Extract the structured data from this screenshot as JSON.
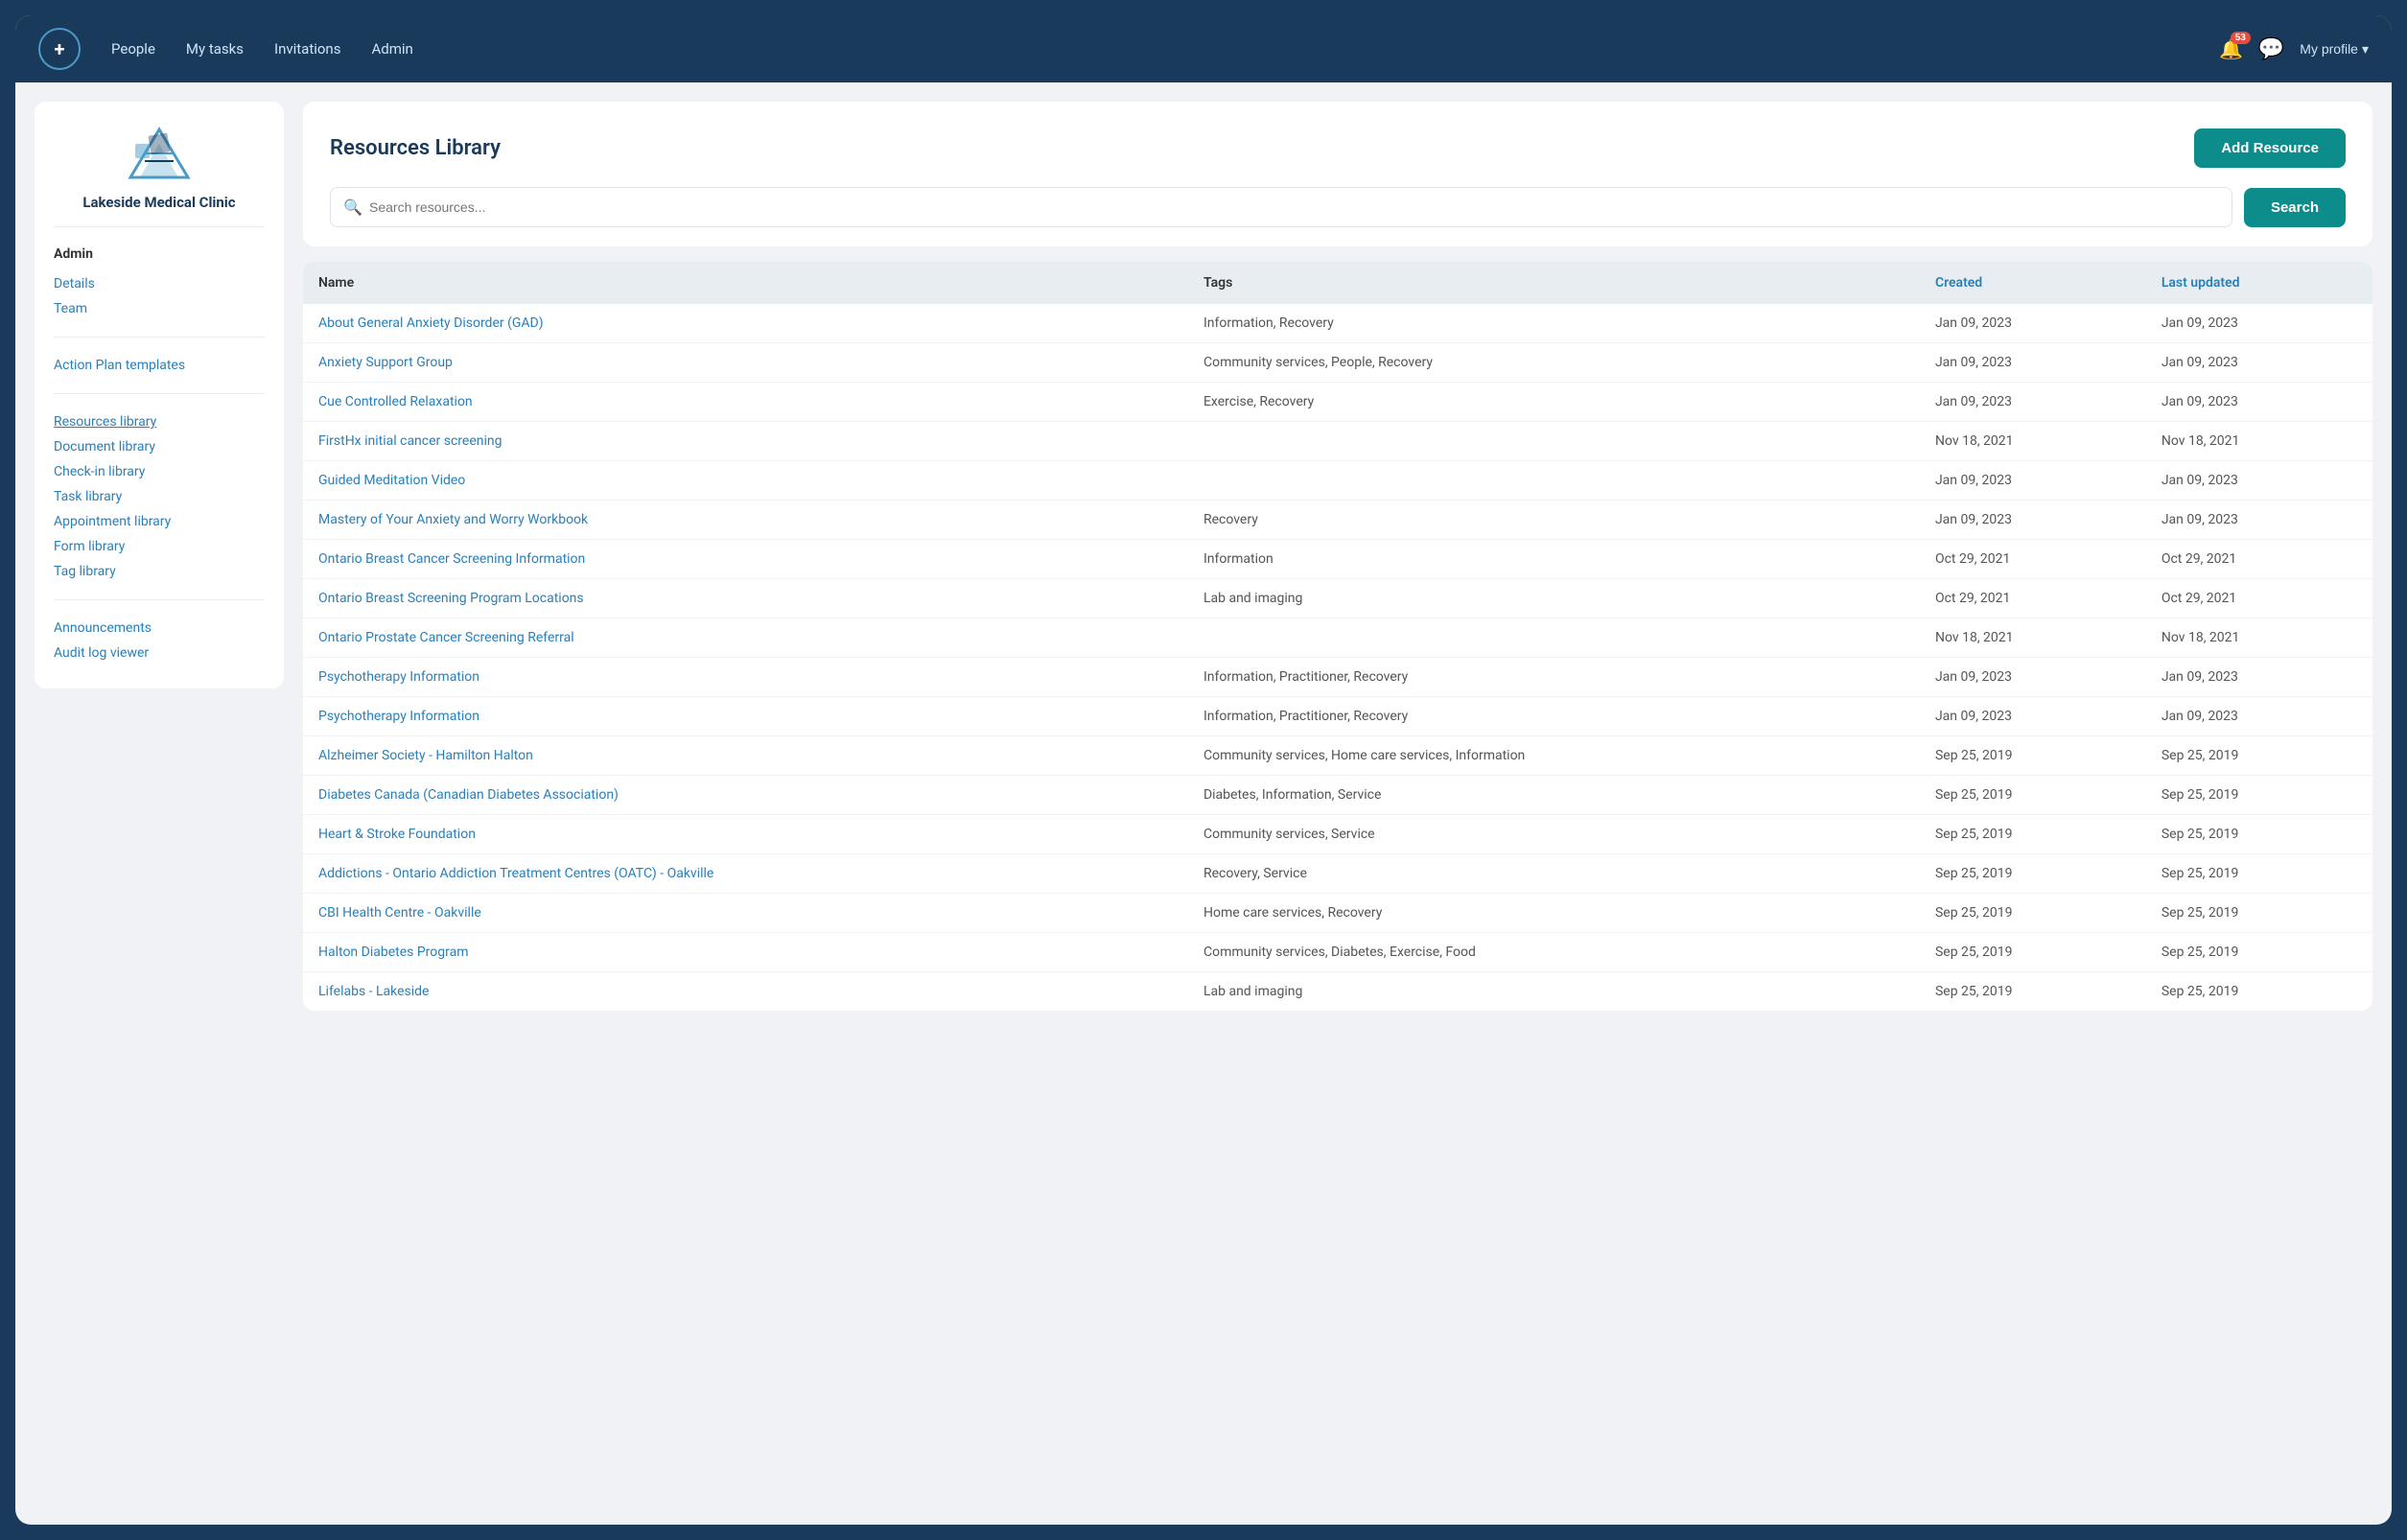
{
  "app": {
    "logo_char": "+"
  },
  "nav": {
    "links": [
      {
        "label": "People",
        "id": "people"
      },
      {
        "label": "My tasks",
        "id": "my-tasks"
      },
      {
        "label": "Invitations",
        "id": "invitations"
      },
      {
        "label": "Admin",
        "id": "admin"
      }
    ],
    "notification_count": "53",
    "profile_label": "My profile"
  },
  "sidebar": {
    "clinic_name": "Lakeside Medical Clinic",
    "admin_section": "Admin",
    "admin_links": [
      {
        "label": "Details",
        "id": "details"
      },
      {
        "label": "Team",
        "id": "team"
      }
    ],
    "action_plan": "Action Plan templates",
    "library_links": [
      {
        "label": "Resources library",
        "id": "resources-library",
        "active": true
      },
      {
        "label": "Document library",
        "id": "document-library"
      },
      {
        "label": "Check-in library",
        "id": "check-in-library"
      },
      {
        "label": "Task library",
        "id": "task-library"
      },
      {
        "label": "Appointment library",
        "id": "appointment-library"
      },
      {
        "label": "Form library",
        "id": "form-library"
      },
      {
        "label": "Tag library",
        "id": "tag-library"
      }
    ],
    "other_links": [
      {
        "label": "Announcements",
        "id": "announcements"
      },
      {
        "label": "Audit log viewer",
        "id": "audit-log-viewer"
      }
    ]
  },
  "resources_panel": {
    "title": "Resources Library",
    "add_button": "Add Resource",
    "search_placeholder": "Search resources...",
    "search_button": "Search"
  },
  "table": {
    "headers": {
      "name": "Name",
      "tags": "Tags",
      "created": "Created",
      "last_updated": "Last updated"
    },
    "rows": [
      {
        "name": "About General Anxiety Disorder (GAD)",
        "tags": "Information, Recovery",
        "created": "Jan 09, 2023",
        "updated": "Jan 09, 2023"
      },
      {
        "name": "Anxiety Support Group",
        "tags": "Community services, People, Recovery",
        "created": "Jan 09, 2023",
        "updated": "Jan 09, 2023"
      },
      {
        "name": "Cue Controlled Relaxation",
        "tags": "Exercise, Recovery",
        "created": "Jan 09, 2023",
        "updated": "Jan 09, 2023"
      },
      {
        "name": "FirstHx initial cancer screening",
        "tags": "",
        "created": "Nov 18, 2021",
        "updated": "Nov 18, 2021"
      },
      {
        "name": "Guided Meditation Video",
        "tags": "",
        "created": "Jan 09, 2023",
        "updated": "Jan 09, 2023"
      },
      {
        "name": "Mastery of Your Anxiety and Worry Workbook",
        "tags": "Recovery",
        "created": "Jan 09, 2023",
        "updated": "Jan 09, 2023"
      },
      {
        "name": "Ontario Breast Cancer Screening Information",
        "tags": "Information",
        "created": "Oct 29, 2021",
        "updated": "Oct 29, 2021"
      },
      {
        "name": "Ontario Breast Screening Program Locations",
        "tags": "Lab and imaging",
        "created": "Oct 29, 2021",
        "updated": "Oct 29, 2021"
      },
      {
        "name": "Ontario Prostate Cancer Screening Referral",
        "tags": "",
        "created": "Nov 18, 2021",
        "updated": "Nov 18, 2021"
      },
      {
        "name": "Psychotherapy Information",
        "tags": "Information, Practitioner, Recovery",
        "created": "Jan 09, 2023",
        "updated": "Jan 09, 2023"
      },
      {
        "name": "Psychotherapy Information",
        "tags": "Information, Practitioner, Recovery",
        "created": "Jan 09, 2023",
        "updated": "Jan 09, 2023"
      },
      {
        "name": "Alzheimer Society - Hamilton Halton",
        "tags": "Community services, Home care services, Information",
        "created": "Sep 25, 2019",
        "updated": "Sep 25, 2019"
      },
      {
        "name": "Diabetes Canada (Canadian Diabetes Association)",
        "tags": "Diabetes, Information, Service",
        "created": "Sep 25, 2019",
        "updated": "Sep 25, 2019"
      },
      {
        "name": "Heart & Stroke Foundation",
        "tags": "Community services, Service",
        "created": "Sep 25, 2019",
        "updated": "Sep 25, 2019"
      },
      {
        "name": "Addictions - Ontario Addiction Treatment Centres (OATC) - Oakville",
        "tags": "Recovery, Service",
        "created": "Sep 25, 2019",
        "updated": "Sep 25, 2019"
      },
      {
        "name": "CBI Health Centre - Oakville",
        "tags": "Home care services, Recovery",
        "created": "Sep 25, 2019",
        "updated": "Sep 25, 2019"
      },
      {
        "name": "Halton Diabetes Program",
        "tags": "Community services, Diabetes, Exercise, Food",
        "created": "Sep 25, 2019",
        "updated": "Sep 25, 2019"
      },
      {
        "name": "Lifelabs - Lakeside",
        "tags": "Lab and imaging",
        "created": "Sep 25, 2019",
        "updated": "Sep 25, 2019"
      }
    ]
  }
}
